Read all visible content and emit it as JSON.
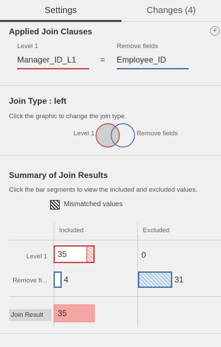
{
  "tabs": {
    "settings": "Settings",
    "changes": "Changes (4)"
  },
  "join_clauses": {
    "title": "Applied Join Clauses",
    "left_label": "Level 1",
    "left_value": "Manager_ID_L1",
    "operator": "=",
    "right_label": "Remove fields",
    "right_value": "Employee_ID"
  },
  "join_type": {
    "title": "Join Type : left",
    "help": "Click the graphic to change the join type.",
    "left_label": "Level 1",
    "right_label": "Remove fields"
  },
  "summary": {
    "title": "Summary of Join Results",
    "help": "Click the bar segments to view the included and excluded values.",
    "legend_mismatched": "Mismatched values",
    "col_included": "Included",
    "col_excluded": "Excluded",
    "rows": [
      {
        "label": "Level 1",
        "included": "35",
        "excluded": "0"
      },
      {
        "label": "Remove fi...",
        "included": "4",
        "excluded": "31"
      }
    ],
    "result_label": "Join Result",
    "result_value": "35"
  },
  "colors": {
    "left": "#c0504d",
    "right": "#4e79a7",
    "result": "#f4a6a4"
  }
}
